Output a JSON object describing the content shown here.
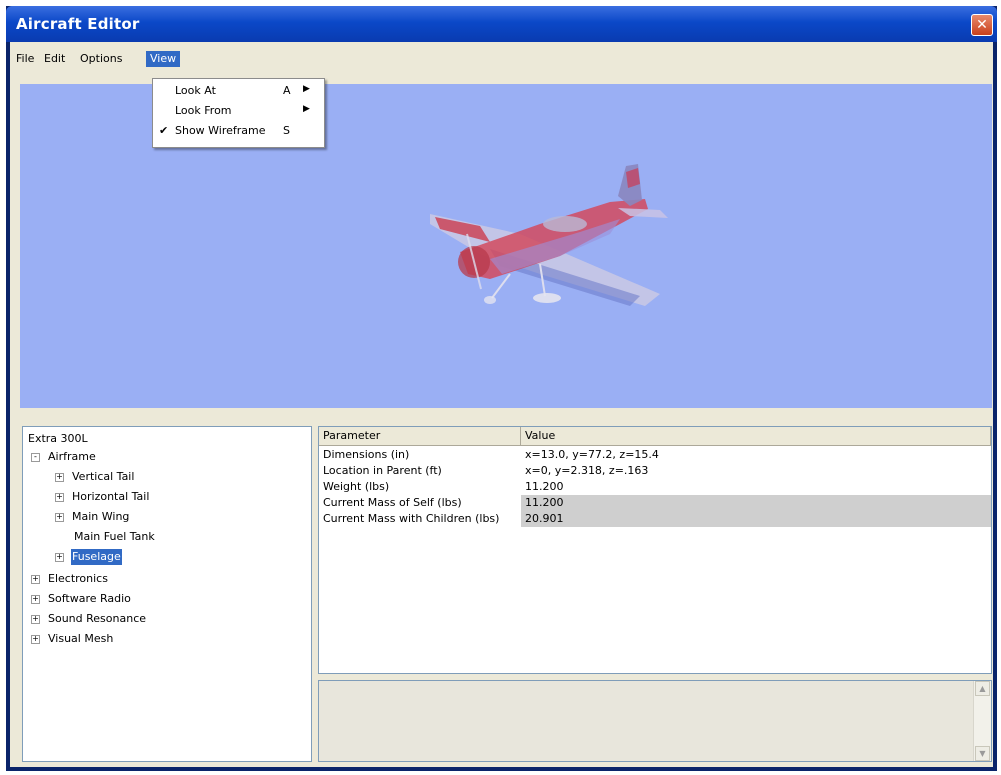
{
  "window": {
    "title": "Aircraft Editor",
    "close_glyph": "✕"
  },
  "menubar": {
    "items": [
      "File",
      "Edit",
      "Options",
      "View"
    ],
    "active": "View"
  },
  "view_menu": {
    "items": [
      {
        "label": "Look At",
        "shortcut": "A",
        "has_submenu": true,
        "checked": false
      },
      {
        "label": "Look From",
        "shortcut": "",
        "has_submenu": true,
        "checked": false
      },
      {
        "label": "Show Wireframe",
        "shortcut": "S",
        "has_submenu": false,
        "checked": true
      }
    ]
  },
  "viewport": {
    "background": "#9aaff4",
    "model_icon": "airplane-model"
  },
  "tree": {
    "root": "Extra 300L",
    "nodes": [
      {
        "label": "Airframe",
        "level": 1,
        "toggle": "-",
        "selected": false
      },
      {
        "label": "Vertical Tail",
        "level": 2,
        "toggle": "+",
        "selected": false
      },
      {
        "label": "Horizontal Tail",
        "level": 2,
        "toggle": "+",
        "selected": false
      },
      {
        "label": "Main Wing",
        "level": 2,
        "toggle": "+",
        "selected": false
      },
      {
        "label": "Main Fuel Tank",
        "level": 2,
        "toggle": "",
        "selected": false
      },
      {
        "label": "Fuselage",
        "level": 2,
        "toggle": "+",
        "selected": true
      },
      {
        "label": "Electronics",
        "level": 1,
        "toggle": "+",
        "selected": false
      },
      {
        "label": "Software Radio",
        "level": 1,
        "toggle": "+",
        "selected": false
      },
      {
        "label": "Sound Resonance",
        "level": 1,
        "toggle": "+",
        "selected": false
      },
      {
        "label": "Visual Mesh",
        "level": 1,
        "toggle": "+",
        "selected": false
      }
    ]
  },
  "grid": {
    "headers": [
      "Parameter",
      "Value"
    ],
    "rows": [
      {
        "param": "Dimensions (in)",
        "value": "x=13.0, y=77.2, z=15.4",
        "readonly": false
      },
      {
        "param": "Location in Parent (ft)",
        "value": "x=0, y=2.318, z=.163",
        "readonly": false
      },
      {
        "param": "Weight (lbs)",
        "value": "11.200",
        "readonly": false
      },
      {
        "param": "Current Mass of Self (lbs)",
        "value": "11.200",
        "readonly": true
      },
      {
        "param": "Current Mass with Children (lbs)",
        "value": "20.901",
        "readonly": true
      }
    ]
  },
  "colors": {
    "title_bar": "#0b48c8",
    "selection": "#316ac5",
    "viewport": "#9aaff4",
    "readonly_row": "#cfcfcf"
  }
}
